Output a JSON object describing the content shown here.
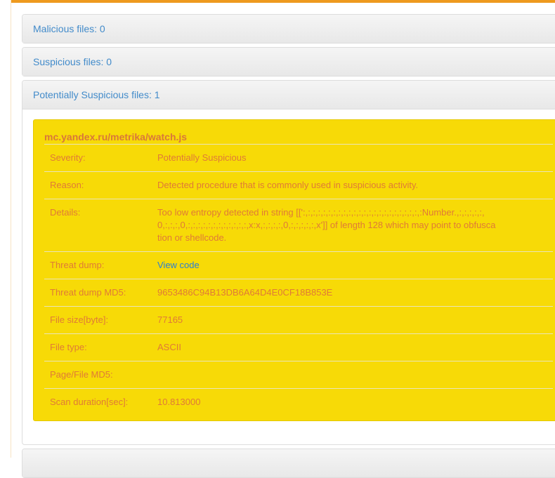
{
  "panels": {
    "malicious": "Malicious files: 0",
    "suspicious": "Suspicious files: 0",
    "potential": "Potentially Suspicious files: 1"
  },
  "file": {
    "title": "mc.yandex.ru/metrika/watch.js",
    "rows": [
      {
        "label": "Severity:",
        "value": "Potentially Suspicious"
      },
      {
        "label": "Reason:",
        "value": "Detected procedure that is commonly used in suspicious activity."
      },
      {
        "label": "Details:",
        "value": "Too low entropy detected in string [[':,:,:,:,:,:,:,:,:,:,:,:,:,:,:,:,:,:,:,:,:,:,:,:Number.,:,:,:,:,:,0,:,:,:,0,:,:,:,:,:,:,:,:,:,:,:,:,x:x,:,:,:,:,0,:,:,:,:,:,x']] of length 128 which may point to obfuscation or shellcode."
      },
      {
        "label": "Threat dump:",
        "value": "View code"
      },
      {
        "label": "Threat dump MD5:",
        "value": "9653486C94B13DB6A64D4E0CF18B853E"
      },
      {
        "label": "File size[byte]:",
        "value": "77165"
      },
      {
        "label": "File type:",
        "value": "ASCII"
      },
      {
        "label": "Page/File MD5:",
        "value": ""
      },
      {
        "label": "Scan duration[sec]:",
        "value": "10.813000"
      }
    ]
  }
}
